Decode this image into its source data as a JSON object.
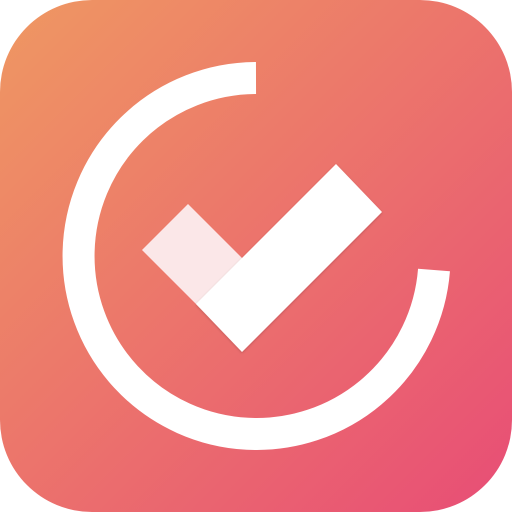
{
  "icon": {
    "name": "task-check-icon",
    "colors": {
      "gradient_start": "#EF9862",
      "gradient_end": "#E84D76",
      "ring": "#FFFFFF",
      "check_long_arm": "#FFFFFF",
      "check_short_arm": "#FBE7E8"
    }
  }
}
